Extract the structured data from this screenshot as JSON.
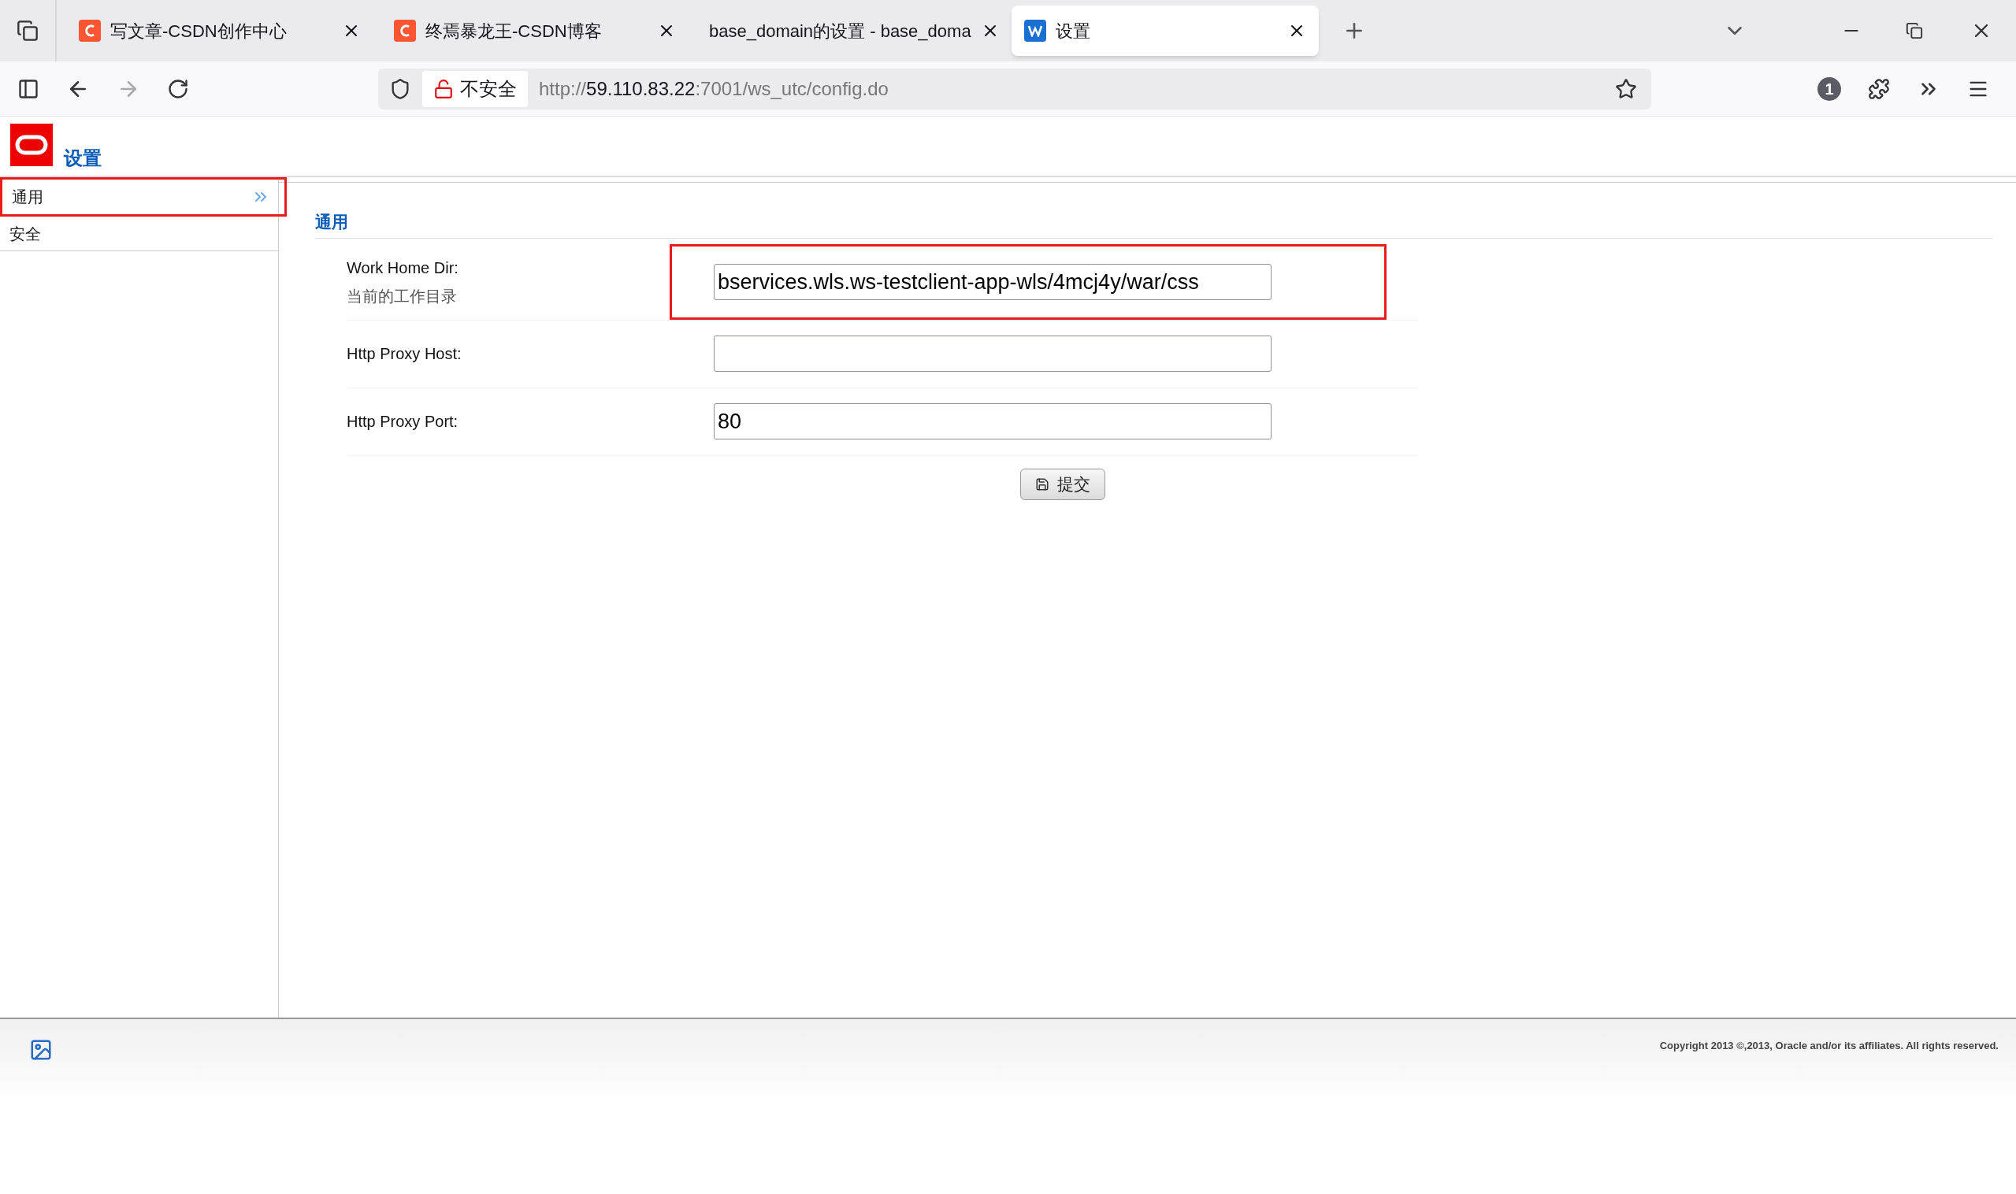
{
  "browser": {
    "tabs": [
      {
        "title": "写文章-CSDN创作中心",
        "kind": "csdn",
        "selected": false
      },
      {
        "title": "终焉暴龙王-CSDN博客",
        "kind": "csdn",
        "selected": false
      },
      {
        "title": "base_domain的设置 - base_doma",
        "kind": "plain",
        "selected": false
      },
      {
        "title": "设置",
        "kind": "weblogic",
        "selected": true
      }
    ],
    "security_label": "不安全",
    "url_scheme": "http://",
    "url_host": "59.110.83.22",
    "url_path": ":7001/ws_utc/config.do",
    "extension_badge": "1"
  },
  "page": {
    "title": "设置",
    "sidebar": [
      {
        "label": "通用",
        "selected": true,
        "highlighted": true
      },
      {
        "label": "安全",
        "selected": false,
        "highlighted": false
      }
    ],
    "section_title": "通用",
    "fields": [
      {
        "label": "Work Home Dir:",
        "hint": "当前的工作目录",
        "value": "bservices.wls.ws-testclient-app-wls/4mcj4y/war/css",
        "highlighted": true
      },
      {
        "label": "Http Proxy Host:",
        "highlighted": false
      },
      {
        "label": "Http Proxy Port:",
        "value": "80",
        "highlighted": false
      }
    ],
    "submit_label": "提交",
    "copyright": "Copyright 2013 ©,2013, Oracle and/or its affiliates. All rights reserved."
  }
}
